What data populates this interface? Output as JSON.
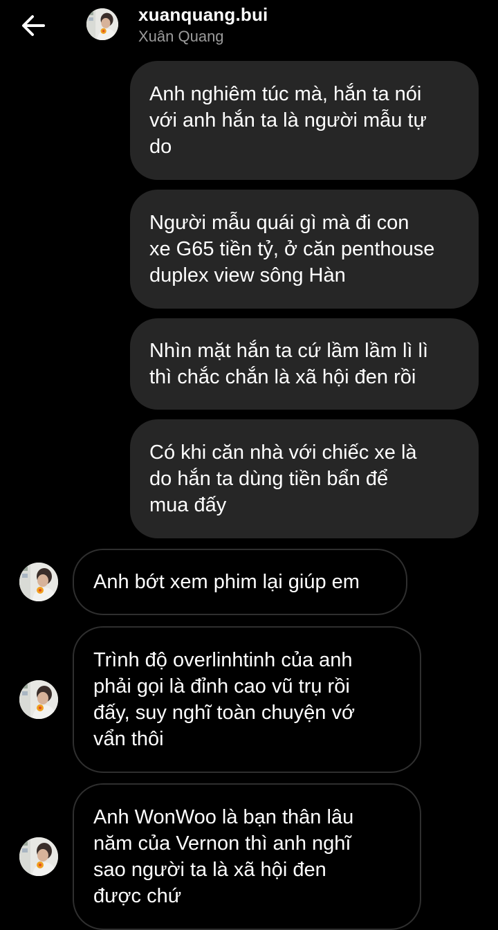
{
  "header": {
    "username": "xuanquang.bui",
    "display_name": "Xuân Quang",
    "back_icon": "arrow-left-icon",
    "avatar_icon": "profile-photo"
  },
  "colors": {
    "background": "#000000",
    "sent_bubble": "#262626",
    "received_border": "#2f2f2f",
    "secondary_text": "#9b9b9b"
  },
  "messages": {
    "sent": [
      "Anh nghiêm túc mà, hắn ta nói\nvới anh hắn ta là người mẫu tự\ndo",
      "Người mẫu quái gì mà đi con\nxe G65 tiền tỷ, ở căn penthouse\nduplex view sông Hàn",
      "Nhìn mặt hắn ta cứ lầm lầm lì lì\nthì chắc chắn là xã hội đen rồi",
      "Có khi căn nhà với chiếc xe là\ndo hắn ta dùng tiền bẩn để\nmua đấy"
    ],
    "received": [
      "Anh bớt xem phim lại giúp em",
      "Trình độ overlinhtinh của anh\nphải gọi là đỉnh cao vũ trụ rồi\nđấy, suy nghĩ toàn chuyện vớ\nvẩn thôi",
      "Anh WonWoo là bạn thân lâu\nnăm của Vernon thì anh nghĩ\nsao người ta là xã hội đen\nđược chứ"
    ]
  }
}
